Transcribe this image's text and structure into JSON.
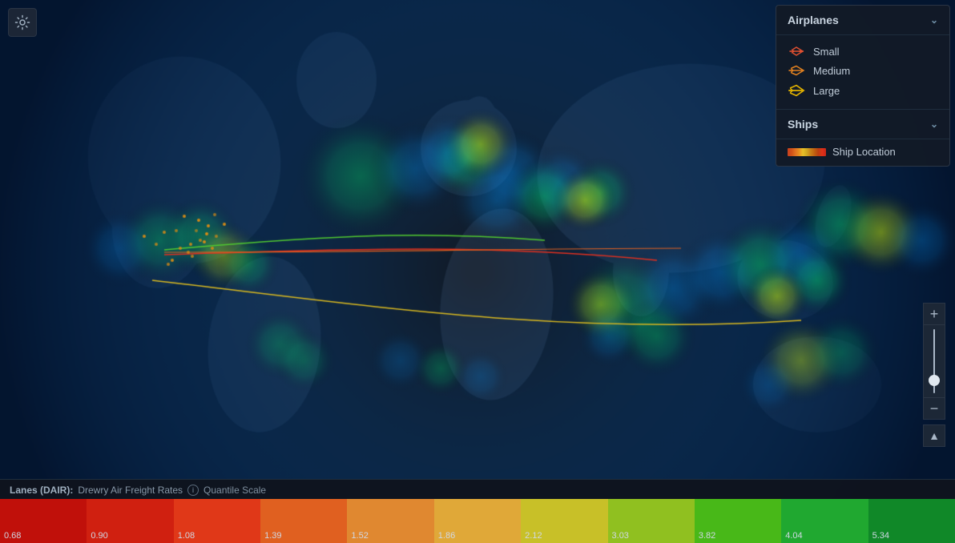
{
  "gear": {
    "label": "⚙"
  },
  "legend": {
    "airplanes": {
      "title": "Airplanes",
      "items": [
        {
          "id": "small",
          "label": "Small",
          "color": "#e05030",
          "size": "small"
        },
        {
          "id": "medium",
          "label": "Medium",
          "color": "#e08020",
          "size": "medium"
        },
        {
          "id": "large",
          "label": "Large",
          "color": "#e0b000",
          "size": "large"
        }
      ]
    },
    "ships": {
      "title": "Ships",
      "item_label": "Ship Location"
    }
  },
  "zoom": {
    "plus_label": "+",
    "minus_label": "−",
    "compass_label": "▲"
  },
  "bottom_bar": {
    "lanes_prefix": "Lanes (DAIR):",
    "data_source": "Drewry Air Freight Rates",
    "scale_type": "Quantile Scale",
    "segments": [
      {
        "value": "0.68",
        "color": "#c0100a"
      },
      {
        "value": "0.90",
        "color": "#d02010"
      },
      {
        "value": "1.08",
        "color": "#e03818"
      },
      {
        "value": "1.39",
        "color": "#e06020"
      },
      {
        "value": "1.52",
        "color": "#e08830"
      },
      {
        "value": "1.86",
        "color": "#e0a838"
      },
      {
        "value": "2.12",
        "color": "#c8c028"
      },
      {
        "value": "3.03",
        "color": "#90c020"
      },
      {
        "value": "3.82",
        "color": "#48b818"
      },
      {
        "value": "4.04",
        "color": "#20a830"
      },
      {
        "value": "5.34",
        "color": "#108828"
      }
    ]
  }
}
